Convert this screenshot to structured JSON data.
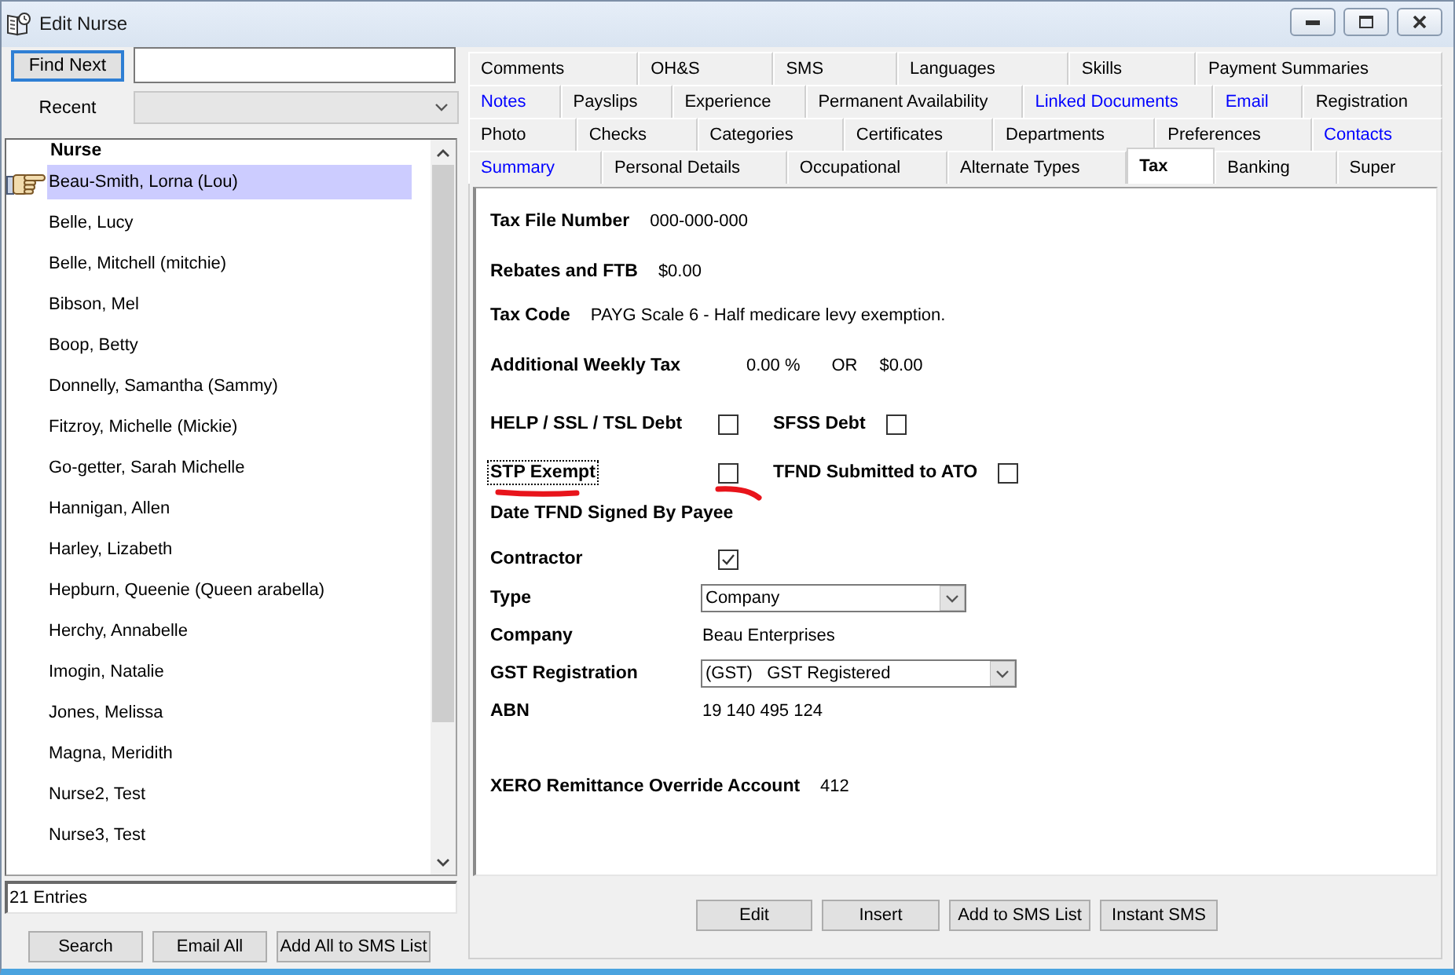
{
  "window": {
    "title": "Edit Nurse"
  },
  "search": {
    "button": "Find Next",
    "default": true
  },
  "recent": {
    "label": "Recent",
    "disabled": true
  },
  "nurse_list": {
    "header": "Nurse",
    "rows": [
      {
        "name": "Beau-Smith, Lorna (Lou)",
        "selected": true
      },
      {
        "name": "Belle, Lucy",
        "selected": false
      },
      {
        "name": "Belle, Mitchell (mitchie)",
        "selected": false
      },
      {
        "name": "Bibson, Mel",
        "selected": false
      },
      {
        "name": "Boop, Betty",
        "selected": false
      },
      {
        "name": "Donnelly, Samantha (Sammy)",
        "selected": false
      },
      {
        "name": "Fitzroy, Michelle (Mickie)",
        "selected": false
      },
      {
        "name": "Go-getter, Sarah Michelle",
        "selected": false
      },
      {
        "name": "Hannigan, Allen",
        "selected": false
      },
      {
        "name": "Harley, Lizabeth",
        "selected": false
      },
      {
        "name": "Hepburn, Queenie (Queen arabella)",
        "selected": false
      },
      {
        "name": "Herchy, Annabelle",
        "selected": false
      },
      {
        "name": "Imogin, Natalie",
        "selected": false
      },
      {
        "name": "Jones, Melissa",
        "selected": false
      },
      {
        "name": "Magna, Meridith",
        "selected": false
      },
      {
        "name": "Nurse2, Test",
        "selected": false
      },
      {
        "name": "Nurse3, Test",
        "selected": false
      }
    ],
    "entry_count": "21 Entries"
  },
  "left_buttons": [
    "Search",
    "Email All",
    "Add All to SMS List"
  ],
  "tab_rows": [
    {
      "tabs": [
        {
          "label": "Comments",
          "selected": false,
          "color": "#000000"
        },
        {
          "label": "OH&S",
          "selected": false,
          "color": "#000000"
        },
        {
          "label": "SMS",
          "selected": false,
          "color": "#000000"
        },
        {
          "label": "Languages",
          "selected": false,
          "color": "#000000"
        },
        {
          "label": "Skills",
          "selected": false,
          "color": "#000000"
        },
        {
          "label": "Payment Summaries",
          "selected": false,
          "color": "#000000"
        }
      ]
    },
    {
      "tabs": [
        {
          "label": "Notes",
          "selected": false,
          "color": "#0000ff"
        },
        {
          "label": "Payslips",
          "selected": false,
          "color": "#000000"
        },
        {
          "label": "Experience",
          "selected": false,
          "color": "#000000"
        },
        {
          "label": "Permanent Availability",
          "selected": false,
          "color": "#000000"
        },
        {
          "label": "Linked Documents",
          "selected": false,
          "color": "#0000ff"
        },
        {
          "label": "Email",
          "selected": false,
          "color": "#0000ff"
        },
        {
          "label": "Registration",
          "selected": false,
          "color": "#000000"
        }
      ]
    },
    {
      "tabs": [
        {
          "label": "Photo",
          "selected": false,
          "color": "#000000"
        },
        {
          "label": "Checks",
          "selected": false,
          "color": "#000000"
        },
        {
          "label": "Categories",
          "selected": false,
          "color": "#000000"
        },
        {
          "label": "Certificates",
          "selected": false,
          "color": "#000000"
        },
        {
          "label": "Departments",
          "selected": false,
          "color": "#000000"
        },
        {
          "label": "Preferences",
          "selected": false,
          "color": "#000000"
        },
        {
          "label": "Contacts",
          "selected": false,
          "color": "#0000ff"
        }
      ]
    },
    {
      "tabs": [
        {
          "label": "Summary",
          "selected": false,
          "color": "#0000ff"
        },
        {
          "label": "Personal Details",
          "selected": false,
          "color": "#000000"
        },
        {
          "label": "Occupational",
          "selected": false,
          "color": "#000000"
        },
        {
          "label": "Alternate Types",
          "selected": false,
          "color": "#000000"
        },
        {
          "label": "Tax",
          "selected": true,
          "color": "#000000"
        },
        {
          "label": "Banking",
          "selected": false,
          "color": "#000000"
        },
        {
          "label": "Super",
          "selected": false,
          "color": "#000000"
        }
      ]
    }
  ],
  "tax_form": {
    "rows": [
      {
        "kind": "text",
        "label": "Tax File Number",
        "value": "000-000-000"
      },
      {
        "kind": "text",
        "label": "Rebates and FTB",
        "value": "$0.00"
      },
      {
        "kind": "text",
        "label": "Tax Code",
        "value": "PAYG Scale 6 - Half medicare levy exemption."
      },
      {
        "kind": "weekly",
        "label": "Additional Weekly Tax",
        "percent": "0.00 %",
        "joiner": "OR",
        "amount": "$0.00"
      },
      {
        "kind": "checks",
        "items": [
          {
            "label": "HELP / SSL / TSL Debt",
            "checked": false,
            "focused": false
          },
          {
            "label": "SFSS Debt",
            "checked": false,
            "focused": false
          }
        ]
      },
      {
        "kind": "checks",
        "items": [
          {
            "label": "STP Exempt",
            "checked": false,
            "focused": true
          },
          {
            "label": "TFND Submitted to ATO",
            "checked": false,
            "focused": false
          }
        ]
      },
      {
        "kind": "label",
        "label": "Date TFND Signed By Payee"
      },
      {
        "kind": "checks",
        "items": [
          {
            "label": "Contractor",
            "checked": true,
            "focused": false
          }
        ]
      },
      {
        "kind": "select",
        "label": "Type",
        "value": "Company"
      },
      {
        "kind": "field",
        "label": "Company",
        "value": "Beau Enterprises"
      },
      {
        "kind": "select",
        "label": "GST Registration",
        "value": "(GST)   GST Registered"
      },
      {
        "kind": "field",
        "label": "ABN",
        "value": "19 140 495 124"
      },
      {
        "kind": "text",
        "label": "XERO Remittance Override Account",
        "value": "412"
      }
    ]
  },
  "bottom_buttons": [
    "Edit",
    "Insert",
    "Add to SMS List",
    "Instant SMS"
  ]
}
